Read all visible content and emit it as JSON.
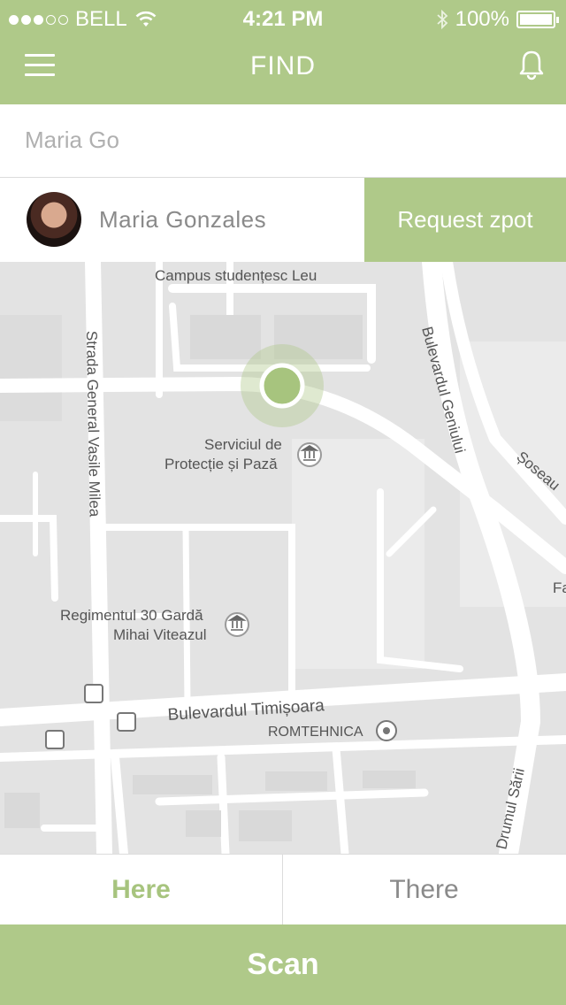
{
  "status_bar": {
    "carrier": "BELL",
    "time": "4:21 PM",
    "battery": "100%",
    "signal_bars_filled": 3,
    "signal_bars_total": 5
  },
  "nav": {
    "title": "FIND"
  },
  "search": {
    "value": "Maria Go",
    "placeholder": ""
  },
  "result": {
    "name": "Maria Gonzales",
    "action_label": "Request zpot"
  },
  "map": {
    "labels": {
      "campus": "Campus studențesc Leu",
      "serviciul_line1": "Serviciul de",
      "serviciul_line2": "Protecție și Pază",
      "regiment_line1": "Regimentul 30 Gardă",
      "regiment_line2": "Mihai Viteazul",
      "strada": "Strada General Vasile Milea",
      "bulevardul_geniului": "Bulevardul Geniului",
      "bulevardul_timisoara": "Bulevardul Timișoara",
      "romtehnica": "ROMTEHNICA",
      "drumul_sarii": "Drumul Sării",
      "soseaua": "Șoseau",
      "fa": "Fa"
    }
  },
  "tabs": [
    {
      "label": "Here",
      "active": true
    },
    {
      "label": "There",
      "active": false
    }
  ],
  "scan": {
    "label": "Scan"
  },
  "colors": {
    "accent": "#afc989",
    "accent_text": "#a7c47e",
    "map_bg": "#e5e5e5"
  },
  "icons": [
    "wifi-icon",
    "bluetooth-icon",
    "battery-icon",
    "menu-icon",
    "bell-icon",
    "avatar",
    "location-pin-icon",
    "museum-icon",
    "transit-icon"
  ]
}
